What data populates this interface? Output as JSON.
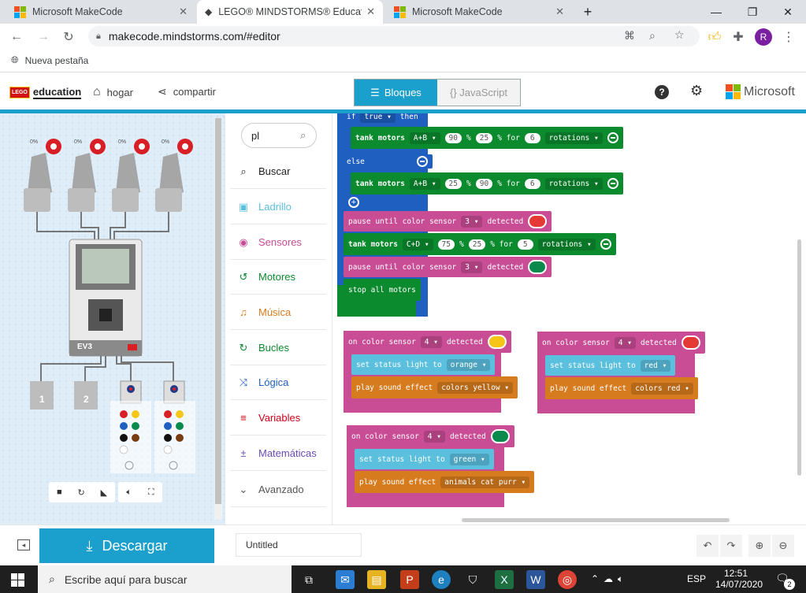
{
  "tabs": [
    {
      "title": "Microsoft MakeCode",
      "active": false
    },
    {
      "title": "LEGO® MINDSTORMS® Educati",
      "active": true
    },
    {
      "title": "Microsoft MakeCode",
      "active": false
    }
  ],
  "browser": {
    "url": "makecode.mindstorms.com/#editor",
    "bookmark": "Nueva pestaña",
    "profile_initial": "R"
  },
  "header": {
    "logo_text": "education",
    "home_label": "hogar",
    "share_label": "compartir",
    "blocks_label": "Bloques",
    "js_label": "{} JavaScript",
    "microsoft_label": "Microsoft"
  },
  "simulator": {
    "port_labels": [
      "1",
      "2"
    ],
    "brick_label": "EV3",
    "motor_speeds": [
      "0%",
      "0%",
      "0%",
      "0%"
    ]
  },
  "toolbox": {
    "search_value": "pl",
    "categories": [
      {
        "label": "Buscar",
        "color": "#222222",
        "icon": "search-icon"
      },
      {
        "label": "Ladrillo",
        "color": "#5bc0de",
        "icon": "brick-icon"
      },
      {
        "label": "Sensores",
        "color": "#c84d95",
        "icon": "sensor-icon"
      },
      {
        "label": "Motores",
        "color": "#0b8a2e",
        "icon": "motor-icon"
      },
      {
        "label": "Música",
        "color": "#d67b1e",
        "icon": "headphones-icon"
      },
      {
        "label": "Bucles",
        "color": "#0b8a2e",
        "icon": "loop-icon"
      },
      {
        "label": "Lógica",
        "color": "#1f5fbf",
        "icon": "shuffle-icon"
      },
      {
        "label": "Variables",
        "color": "#d0021b",
        "icon": "list-icon"
      },
      {
        "label": "Matemáticas",
        "color": "#6a4bb6",
        "icon": "math-icon"
      },
      {
        "label": "Avanzado",
        "color": "#555555",
        "icon": "chevron-down-icon"
      }
    ]
  },
  "blocks": {
    "if_kw": "if",
    "if_cond": "true",
    "then_kw": "then",
    "else_kw": "else",
    "tank1": {
      "label": "tank motors",
      "ports": "A+B",
      "v1": "90",
      "v2": "25",
      "rot": "6",
      "unit": "rotations"
    },
    "tank2": {
      "label": "tank motors",
      "ports": "A+B",
      "v1": "25",
      "v2": "90",
      "rot": "6",
      "unit": "rotations"
    },
    "pause1": {
      "label": "pause until color sensor",
      "port": "3",
      "suffix": "detected",
      "color": "#e53935"
    },
    "tank3": {
      "label": "tank motors",
      "ports": "C+D",
      "v1": "75",
      "v2": "25",
      "rot": "5",
      "unit": "rotations"
    },
    "pause2": {
      "label": "pause until color sensor",
      "port": "3",
      "suffix": "detected",
      "color": "#0b8a4e"
    },
    "stop": "stop all motors",
    "pct": "%",
    "pct_for": "% for",
    "event1": {
      "label": "on color sensor",
      "port": "4",
      "suffix": "detected",
      "color": "#f5c518",
      "status_label": "set status light to",
      "status": "orange",
      "sound_label": "play sound effect",
      "sound": "colors yellow"
    },
    "event2": {
      "label": "on color sensor",
      "port": "4",
      "suffix": "detected",
      "color": "#e53935",
      "status_label": "set status light to",
      "status": "red",
      "sound_label": "play sound effect",
      "sound": "colors red"
    },
    "event3": {
      "label": "on color sensor",
      "port": "4",
      "suffix": "detected",
      "color": "#0b8a4e",
      "status_label": "set status light to",
      "status": "green",
      "sound_label": "play sound effect",
      "sound": "animals cat purr"
    }
  },
  "footer": {
    "download_label": "Descargar",
    "project_name": "Untitled"
  },
  "taskbar": {
    "search_placeholder": "Escribe aquí para buscar",
    "lang": "ESP",
    "time": "12:51",
    "date": "14/07/2020",
    "notif_count": "2"
  }
}
